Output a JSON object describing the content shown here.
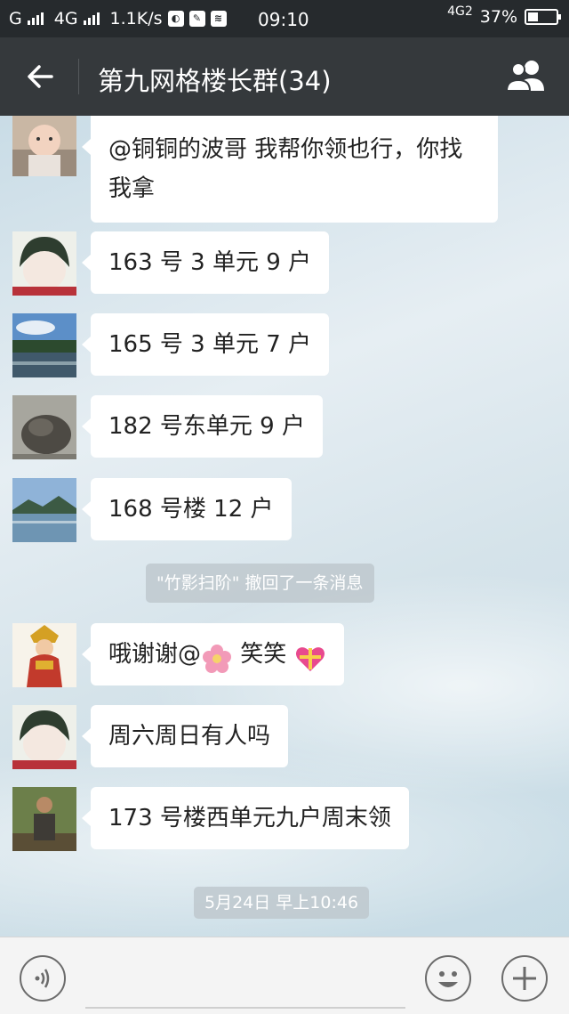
{
  "status_bar": {
    "left": [
      "G",
      "4G",
      "1.1K/s"
    ],
    "icon_a": "4G",
    "icon_b": "N",
    "icon_c": "S",
    "time": "09:10",
    "network": "4G2",
    "battery": "37%",
    "battery_level": 0.37
  },
  "header": {
    "title": "第九网格楼长群(34)"
  },
  "messages": [
    {
      "text": "@铜铜的波哥  我帮你领也行，你找我拿",
      "avatar": "baby-photo-avatar"
    },
    {
      "text": "163 号 3 单元 9 户",
      "avatar": "cartoon-avatar"
    },
    {
      "text": "165 号 3 单元 7 户",
      "avatar": "lake-landscape-avatar"
    },
    {
      "text": "182 号东单元 9 户",
      "avatar": "rock-avatar"
    },
    {
      "text": "168 号楼 12 户",
      "avatar": "lake-mountain-avatar"
    },
    {
      "text": "哦谢谢@",
      "text2": " 笑笑 ",
      "avatar": "opera-character-avatar"
    },
    {
      "text": "周六周日有人吗",
      "avatar": "cartoon-avatar"
    },
    {
      "text": "173 号楼西单元九户周末领",
      "avatar": "man-outdoors-avatar"
    }
  ],
  "system": {
    "recall": "\"竹影扫阶\" 撤回了一条消息",
    "timestamp": "5月24日 早上10:46"
  },
  "colors": {
    "status_bg": "#262a2d",
    "title_bg": "#35393c",
    "bubble": "#ffffff"
  }
}
